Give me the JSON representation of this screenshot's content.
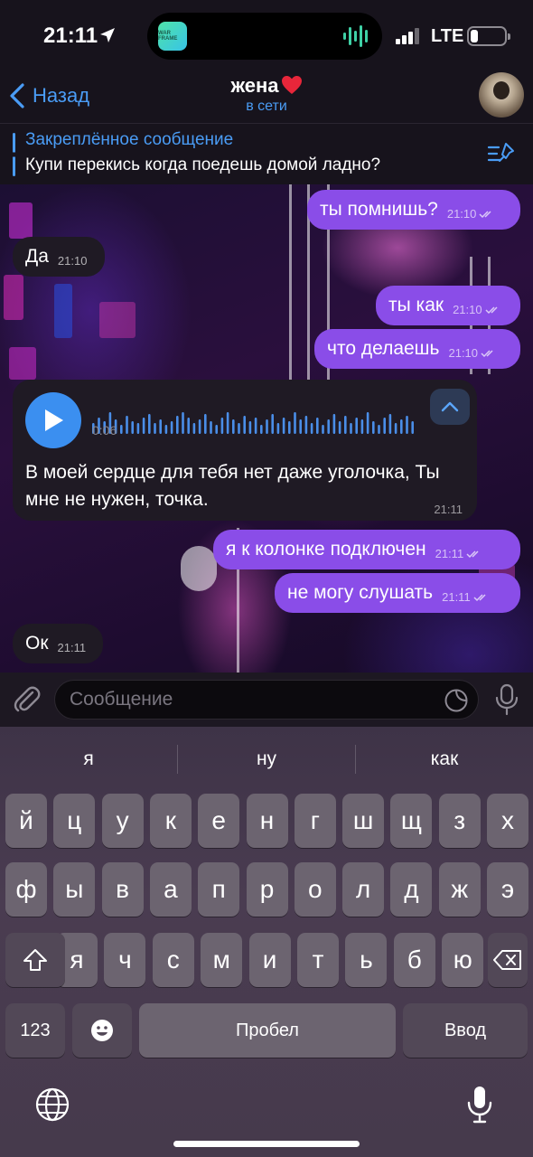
{
  "status_bar": {
    "time": "21:11",
    "network": "LTE",
    "island_app_label": "WAR FRAME"
  },
  "header": {
    "back_label": "Назад",
    "title": "жена",
    "title_emoji": "heart",
    "status": "в сети"
  },
  "pinned": {
    "title": "Закреплённое сообщение",
    "text": "Купи перекись когда поедешь домой ладно?"
  },
  "messages": [
    {
      "dir": "out",
      "text": "ты помнишь?",
      "time": "21:10",
      "read": true
    },
    {
      "dir": "in",
      "text": "Да",
      "time": "21:10"
    },
    {
      "dir": "out",
      "text": "ты как",
      "time": "21:10",
      "read": true
    },
    {
      "dir": "out",
      "text": "что делаешь",
      "time": "21:10",
      "read": true
    },
    {
      "dir": "in",
      "type": "voice",
      "duration": "0:06",
      "transcript": "В моей сердце для тебя нет даже уголочка, Ты мне не нужен, точка.",
      "time": "21:11"
    },
    {
      "dir": "out",
      "text": "я к колонке подключен",
      "time": "21:11",
      "read": true
    },
    {
      "dir": "out",
      "text": "не могу слушать",
      "time": "21:11",
      "read": true
    },
    {
      "dir": "in",
      "text": "Ок",
      "time": "21:11"
    }
  ],
  "input": {
    "placeholder": "Сообщение"
  },
  "keyboard": {
    "suggestions": [
      "я",
      "ну",
      "как"
    ],
    "row1": [
      "й",
      "ц",
      "у",
      "к",
      "е",
      "н",
      "г",
      "ш",
      "щ",
      "з",
      "х"
    ],
    "row2": [
      "ф",
      "ы",
      "в",
      "а",
      "п",
      "р",
      "о",
      "л",
      "д",
      "ж",
      "э"
    ],
    "row3": [
      "я",
      "ч",
      "с",
      "м",
      "и",
      "т",
      "ь",
      "б",
      "ю"
    ],
    "numbers_label": "123",
    "space_label": "Пробел",
    "return_label": "Ввод"
  },
  "colors": {
    "accent": "#4a9cf5",
    "outgoing_bubble": "#8a4de8",
    "incoming_bubble": "#1f1a24"
  }
}
